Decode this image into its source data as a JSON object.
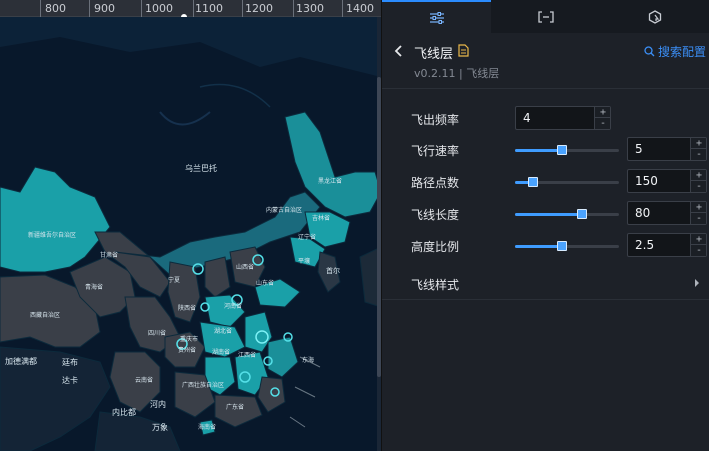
{
  "ruler": {
    "ticks": [
      "800",
      "900",
      "1000",
      "1100",
      "1200",
      "1300",
      "1400"
    ]
  },
  "map": {
    "labels": {
      "wulanbatuo": "乌兰巴托",
      "xinjiang": "新疆维吾尔自治区",
      "xizang": "西藏自治区",
      "qinghai": "青海省",
      "gansu": "甘肃省",
      "neimenggu": "内蒙古自治区",
      "heilongjiang": "黑龙江省",
      "jilin": "吉林省",
      "liaoning": "辽宁省",
      "pingrang": "平壤",
      "shouer": "首尔",
      "sichuan": "四川省",
      "chongqing": "重庆市",
      "guizhou": "贵州省",
      "yunnan": "云南省",
      "guangxi": "广西壮族自治区",
      "hunan": "湖南省",
      "jiangxi": "江西省",
      "hubei": "湖北省",
      "henan": "河南省",
      "shandong": "山东省",
      "shanxi": "山西省",
      "ningxia": "宁夏",
      "shaanxi": "陕西省",
      "guangdong": "广东省",
      "hainan": "海南省",
      "dongjing": "东海",
      "jiademan": "加德满都",
      "xibu": "廷布",
      "daka": "达卡",
      "neibidu": "内比都",
      "wanxiang": "万象",
      "henei": "河内"
    }
  },
  "panel": {
    "title": "飞线层",
    "version": "v0.2.11 | 飞线层",
    "search_link": "搜索配置",
    "rows": [
      {
        "label": "飞出频率",
        "value": "4"
      },
      {
        "label": "飞行速率",
        "value": "5",
        "slider": 0.45
      },
      {
        "label": "路径点数",
        "value": "150",
        "slider": 0.17
      },
      {
        "label": "飞线长度",
        "value": "80",
        "slider": 0.64
      },
      {
        "label": "高度比例",
        "value": "2.5",
        "slider": 0.45
      }
    ],
    "section_label": "飞线样式",
    "spin_up": "+",
    "spin_down": "-"
  },
  "colors": {
    "accent": "#2b8cff",
    "province_teal": "#1aa0a8",
    "province_dark": "#3a3f48",
    "background": "#08182b"
  }
}
